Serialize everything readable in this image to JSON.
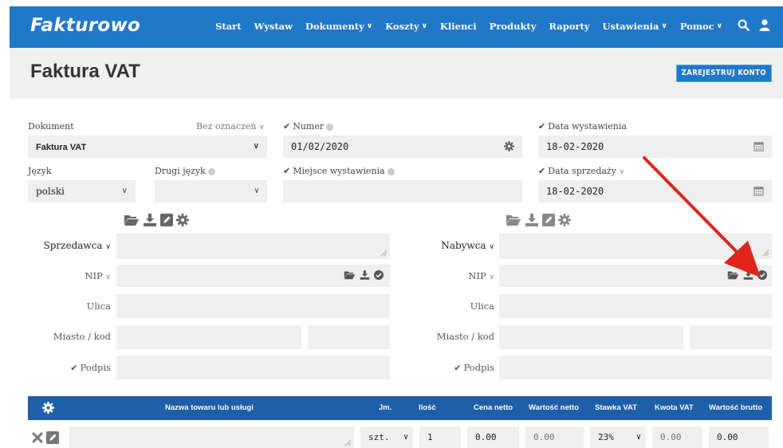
{
  "nav": {
    "logo": "Fakturowo",
    "items": [
      {
        "label": "Start",
        "dropdown": false
      },
      {
        "label": "Wystaw",
        "dropdown": false
      },
      {
        "label": "Dokumenty",
        "dropdown": true
      },
      {
        "label": "Koszty",
        "dropdown": true
      },
      {
        "label": "Klienci",
        "dropdown": false
      },
      {
        "label": "Produkty",
        "dropdown": false
      },
      {
        "label": "Raporty",
        "dropdown": false
      },
      {
        "label": "Ustawienia",
        "dropdown": true
      },
      {
        "label": "Pomoc",
        "dropdown": true
      }
    ],
    "icons": [
      "search-icon",
      "user-icon"
    ]
  },
  "header": {
    "title": "Faktura VAT",
    "register_button": "ZAREJESTRUJ KONTO"
  },
  "document": {
    "label": "Dokument",
    "marking_label": "Bez oznaczeń",
    "value": "Faktura VAT"
  },
  "number": {
    "label": "Numer",
    "value": "01/02/2020"
  },
  "issue_date": {
    "label": "Data wystawienia",
    "value": "18-02-2020"
  },
  "language": {
    "label": "Język",
    "value": "polski"
  },
  "second_language": {
    "label": "Drugi język",
    "value": ""
  },
  "place": {
    "label": "Miejsce wystawienia",
    "value": ""
  },
  "sale_date": {
    "label": "Data sprzedaży",
    "value": "18-02-2020"
  },
  "seller": {
    "label": "Sprzedawca",
    "nip_label": "NIP",
    "street_label": "Ulica",
    "city_label": "Miasto / kod",
    "signature_label": "Podpis"
  },
  "buyer": {
    "label": "Nabywca",
    "nip_label": "NIP",
    "street_label": "Ulica",
    "city_label": "Miasto / kod",
    "signature_label": "Podpis"
  },
  "table": {
    "headers": {
      "name": "Nazwa towaru lub usługi",
      "unit": "Jm.",
      "qty": "Ilość",
      "net_price": "Cena netto",
      "net_value": "Wartość netto",
      "vat_rate": "Stawka VAT",
      "vat_amount": "Kwota VAT",
      "gross_value": "Wartość brutto"
    },
    "row": {
      "name": "",
      "unit": "szt.",
      "qty": "1",
      "net_price": "0.00",
      "net_value": "0.00",
      "vat_rate": "23%",
      "vat_amount": "0.00",
      "gross_value": "0.00"
    }
  },
  "colors": {
    "nav": "#1f78c8",
    "table_header": "#1f5ea8",
    "field_bg": "#efefef",
    "arrow": "#e0251b"
  }
}
